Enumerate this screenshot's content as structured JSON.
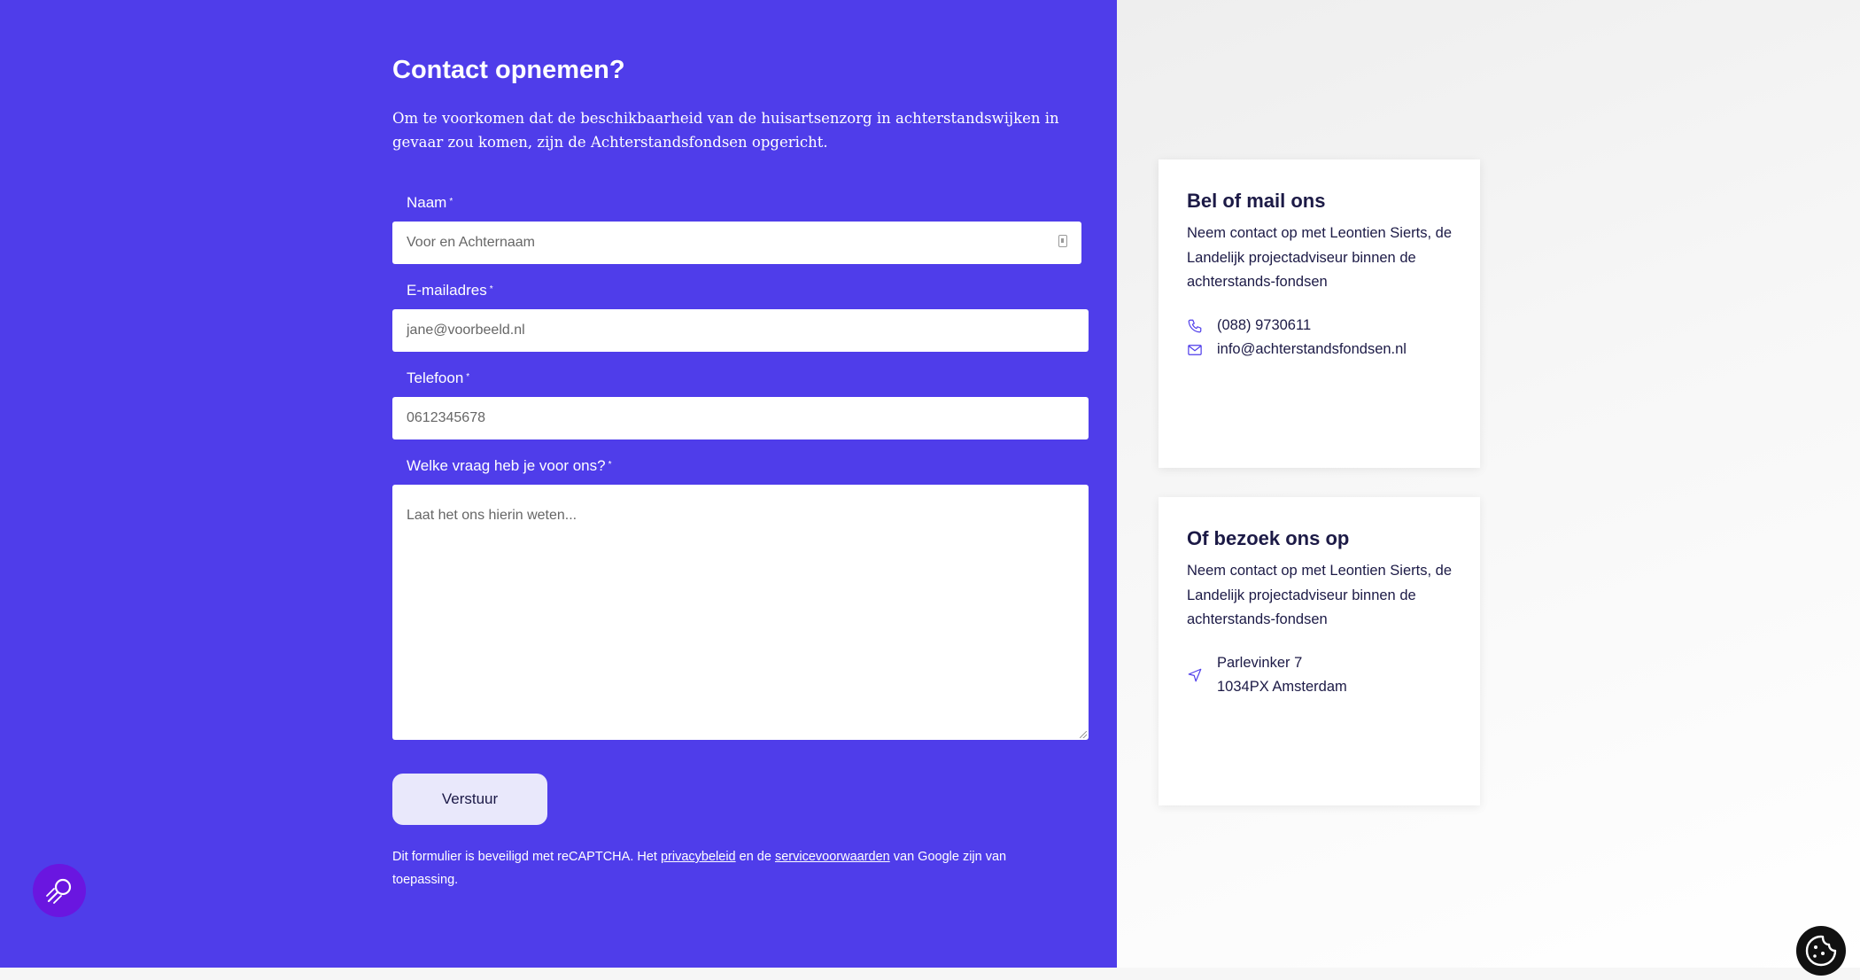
{
  "form": {
    "title": "Contact opnemen?",
    "intro": "Om te voorkomen dat de beschikbaarheid van de huisartsenzorg in achterstandswijken in gevaar zou komen, zijn de Achterstandsfondsen opgericht.",
    "required_marker": "*",
    "name_label": "Naam",
    "name_placeholder": "Voor en Achternaam",
    "email_label": "E-mailadres",
    "email_placeholder": "jane@voorbeeld.nl",
    "phone_label": "Telefoon",
    "phone_placeholder": "0612345678",
    "question_label": "Welke vraag heb je voor ons?",
    "question_placeholder": "Laat het ons hierin weten...",
    "submit_label": "Verstuur",
    "legal_text_1": "Dit formulier is beveiligd met reCAPTCHA. Het ",
    "privacy_link": "privacybeleid",
    "legal_text_2": " en de ",
    "terms_link": "servicevoorwaarden",
    "legal_text_3": " van Google zijn van toepassing."
  },
  "contact_card": {
    "title": "Bel of mail ons",
    "text": "Neem contact op met Leontien Sierts, de Landelijk projectadviseur binnen de achterstands-fondsen",
    "phone": "(088) 9730611",
    "email": "info@achterstandsfondsen.nl"
  },
  "visit_card": {
    "title": "Of bezoek ons op",
    "text": "Neem contact op met Leontien Sierts, de Landelijk projectadviseur binnen de achterstands-fondsen",
    "address_line1": "Parlevinker 7",
    "address_line2": "1034PX Amsterdam"
  },
  "colors": {
    "primary": "#4f3dea",
    "button_bg": "#e9e8fb",
    "text_dark": "#1c1a46",
    "magic_button": "#6a16e0"
  },
  "icons": {
    "phone": "phone-icon",
    "mail": "mail-icon",
    "location": "location-arrow-icon",
    "magic": "magic-search-icon",
    "cookie": "cookie-icon"
  }
}
